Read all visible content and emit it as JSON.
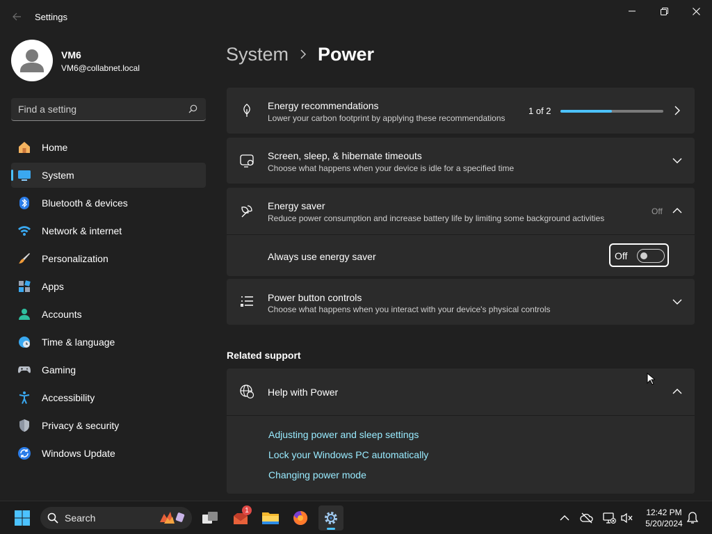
{
  "window": {
    "title": "Settings"
  },
  "profile": {
    "name": "VM6",
    "email": "VM6@collabnet.local"
  },
  "search": {
    "placeholder": "Find a setting"
  },
  "sidebar": {
    "items": [
      {
        "label": "Home",
        "icon": "home-icon"
      },
      {
        "label": "System",
        "icon": "system-icon",
        "selected": true
      },
      {
        "label": "Bluetooth & devices",
        "icon": "bluetooth-icon"
      },
      {
        "label": "Network & internet",
        "icon": "wifi-icon"
      },
      {
        "label": "Personalization",
        "icon": "brush-icon"
      },
      {
        "label": "Apps",
        "icon": "apps-icon"
      },
      {
        "label": "Accounts",
        "icon": "accounts-icon"
      },
      {
        "label": "Time & language",
        "icon": "time-language-icon"
      },
      {
        "label": "Gaming",
        "icon": "gaming-icon"
      },
      {
        "label": "Accessibility",
        "icon": "accessibility-icon"
      },
      {
        "label": "Privacy & security",
        "icon": "shield-icon"
      },
      {
        "label": "Windows Update",
        "icon": "windows-update-icon"
      }
    ]
  },
  "breadcrumb": {
    "parent": "System",
    "current": "Power"
  },
  "cards": {
    "energy_recommendations": {
      "title": "Energy recommendations",
      "desc": "Lower your carbon footprint by applying these recommendations",
      "progress_text": "1 of 2",
      "progress_fraction": 0.5
    },
    "screen_sleep": {
      "title": "Screen, sleep, & hibernate timeouts",
      "desc": "Choose what happens when your device is idle for a specified time"
    },
    "energy_saver": {
      "title": "Energy saver",
      "desc": "Reduce power consumption and increase battery life by limiting some background activities",
      "status": "Off",
      "always_label": "Always use energy saver",
      "toggle_label": "Off",
      "toggle_on": false
    },
    "power_button": {
      "title": "Power button controls",
      "desc": "Choose what happens when you interact with your device's physical controls"
    }
  },
  "related_support": {
    "heading": "Related support",
    "help_title": "Help with Power",
    "links": [
      "Adjusting power and sleep settings",
      "Lock your Windows PC automatically",
      "Changing power mode"
    ]
  },
  "taskbar": {
    "search_label": "Search",
    "notification_count": "1",
    "time": "12:42 PM",
    "date": "5/20/2024"
  },
  "colors": {
    "accent": "#4cc2ff",
    "link": "#99ebff",
    "background": "#202020",
    "card": "#2b2b2b"
  }
}
